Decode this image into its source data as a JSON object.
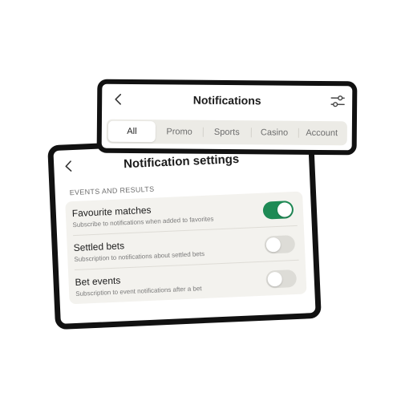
{
  "notifications": {
    "title": "Notifications",
    "tabs": [
      {
        "label": "All",
        "active": true
      },
      {
        "label": "Promo",
        "active": false
      },
      {
        "label": "Sports",
        "active": false
      },
      {
        "label": "Casino",
        "active": false
      },
      {
        "label": "Account",
        "active": false
      }
    ],
    "icons": {
      "back": "chevron-left-icon",
      "filter": "sliders-icon"
    }
  },
  "settings": {
    "title": "Notification settings",
    "section_label": "EVENTS AND RESULTS",
    "items": [
      {
        "title": "Favourite matches",
        "description": "Subscribe to notifications when added to favorites",
        "enabled": true
      },
      {
        "title": "Settled bets",
        "description": "Subscription to notifications about settled bets",
        "enabled": false
      },
      {
        "title": "Bet events",
        "description": "Subscription to event notifications after a bet",
        "enabled": false
      }
    ]
  },
  "colors": {
    "toggle_on": "#1e8a55",
    "toggle_off": "#dddcd7",
    "list_background": "#f3f2ee",
    "frame": "#111111"
  }
}
